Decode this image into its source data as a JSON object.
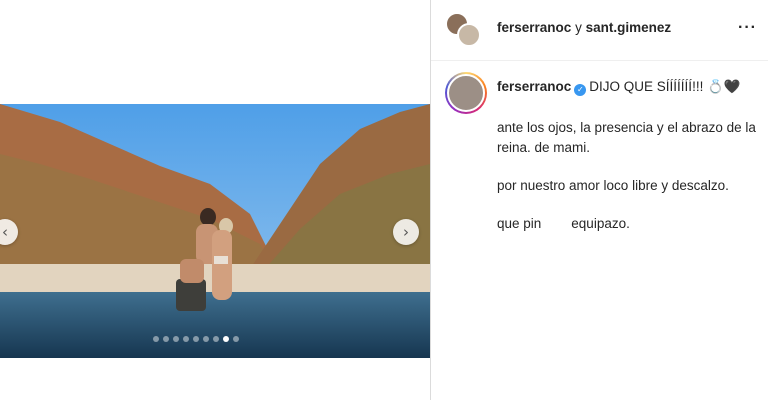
{
  "header": {
    "user1": "ferserranoc",
    "connector": "y",
    "user2": "sant.gimenez",
    "more_icon": "more-horizontal-icon"
  },
  "caption": {
    "username": "ferserranoc",
    "verified_icon": "verified-badge-icon",
    "headline": "DIJO QUE SÍÍÍÍÍÍÍ!!! 💍🖤",
    "paragraphs": [
      "ante los ojos, la presencia y el abrazo de la reina. de mami.",
      "por nuestro amor loco libre y descalzo.",
      "que pin        equipazo."
    ]
  },
  "carousel": {
    "total": 9,
    "active_index": 7,
    "prev_icon": "chevron-left-icon",
    "next_icon": "chevron-right-icon"
  }
}
